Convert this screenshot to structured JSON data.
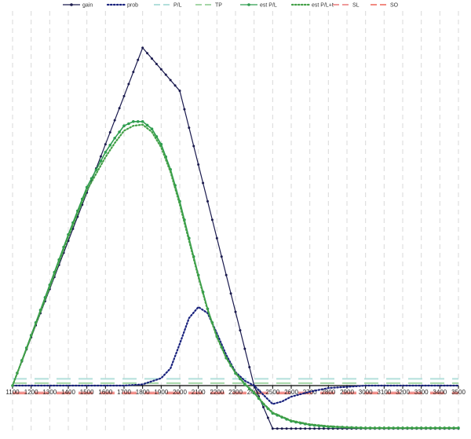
{
  "chart_data": {
    "type": "line",
    "title": "",
    "xlabel": "",
    "ylabel": "",
    "xlim": [
      1100,
      3500
    ],
    "ylim": [
      -0.078,
      0.61
    ],
    "x_ticks": [
      1100,
      1200,
      1300,
      1400,
      1500,
      1600,
      1700,
      1800,
      1900,
      2000,
      2100,
      2200,
      2300,
      2400,
      2500,
      2600,
      2700,
      2800,
      2900,
      3000,
      3100,
      3200,
      3300,
      3400,
      3500
    ],
    "x_tick_labels": [
      "1100",
      "1200",
      "1300",
      "1400",
      "1500",
      "1600",
      "1700",
      "1800",
      "1900",
      "2000",
      "2100",
      "2200",
      "2300",
      "2400",
      "2500",
      "2600",
      "2700",
      "2800",
      "2900",
      "3000",
      "3100",
      "3200",
      "3300",
      "3400",
      "3500"
    ],
    "grid": {
      "vertical": true,
      "horizontal": false,
      "style": "dashed"
    },
    "legend": {
      "position": "top"
    },
    "series": [
      {
        "name": "gain",
        "color": "#1a1a4e",
        "style": "solid-dots",
        "x": [
          1100,
          1800,
          2000,
          2400,
          2500,
          3500
        ],
        "y": [
          0.0,
          0.55,
          0.48,
          0.0,
          -0.07,
          -0.07
        ]
      },
      {
        "name": "prob",
        "color": "#1a237e",
        "style": "dotted",
        "x": [
          1100,
          1700,
          1800,
          1900,
          1950,
          2000,
          2050,
          2100,
          2150,
          2200,
          2250,
          2300,
          2350,
          2400,
          2500,
          2550,
          2600,
          2700,
          2800,
          2900,
          3000,
          3500
        ],
        "y": [
          0.0,
          0.0,
          0.002,
          0.012,
          0.028,
          0.068,
          0.11,
          0.128,
          0.118,
          0.085,
          0.05,
          0.022,
          0.008,
          0.0,
          -0.03,
          -0.026,
          -0.018,
          -0.01,
          -0.004,
          -0.002,
          0.0,
          0.0
        ]
      },
      {
        "name": "P/L",
        "color": "#b2dfdb",
        "style": "dashed",
        "y_const": 0.011
      },
      {
        "name": "TP",
        "color": "#a5d6a7",
        "style": "dashed",
        "y_const": 0.004
      },
      {
        "name": "est P/L",
        "color": "#2e9d4f",
        "style": "solid-dots",
        "x": [
          1100,
          1200,
          1300,
          1400,
          1500,
          1600,
          1650,
          1700,
          1750,
          1800,
          1850,
          1900,
          1950,
          2000,
          2050,
          2100,
          2150,
          2200,
          2250,
          2300,
          2350,
          2400,
          2450,
          2500,
          2600,
          2700,
          2800,
          2900,
          3000,
          3500
        ],
        "y": [
          0.0,
          0.082,
          0.164,
          0.246,
          0.323,
          0.38,
          0.403,
          0.423,
          0.43,
          0.43,
          0.418,
          0.393,
          0.352,
          0.3,
          0.24,
          0.18,
          0.125,
          0.08,
          0.045,
          0.02,
          0.002,
          -0.012,
          -0.03,
          -0.045,
          -0.058,
          -0.064,
          -0.067,
          -0.068,
          -0.069,
          -0.069
        ]
      },
      {
        "name": "est P/L+t",
        "color": "#43a047",
        "style": "dotted",
        "x": [
          1100,
          1200,
          1300,
          1400,
          1500,
          1600,
          1650,
          1700,
          1750,
          1800,
          1850,
          1900,
          1950,
          2000,
          2050,
          2100,
          2150,
          2200,
          2250,
          2300,
          2350,
          2400,
          2450,
          2500,
          2600,
          2700,
          2800,
          2900,
          3000,
          3500
        ],
        "y": [
          0.0,
          0.08,
          0.16,
          0.242,
          0.318,
          0.372,
          0.395,
          0.415,
          0.423,
          0.425,
          0.413,
          0.388,
          0.348,
          0.295,
          0.236,
          0.177,
          0.123,
          0.079,
          0.045,
          0.021,
          0.003,
          -0.011,
          -0.029,
          -0.044,
          -0.057,
          -0.063,
          -0.066,
          -0.068,
          -0.069,
          -0.069
        ]
      },
      {
        "name": "SL",
        "color": "#ef9a9a",
        "style": "dashed",
        "y_const": -0.011
      },
      {
        "name": "SO",
        "color": "#f28b82",
        "style": "dashed",
        "y_const": -0.013
      }
    ]
  }
}
